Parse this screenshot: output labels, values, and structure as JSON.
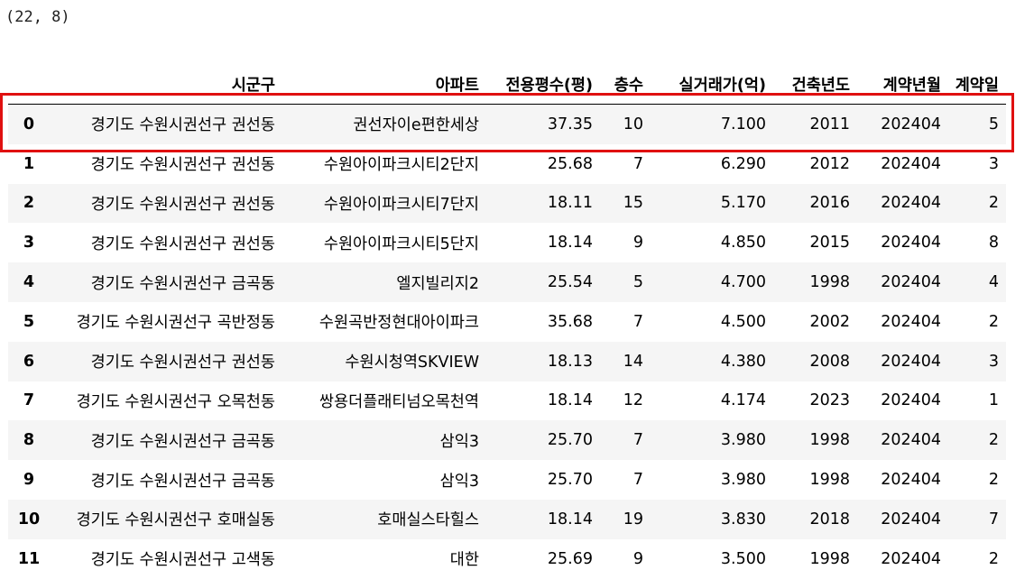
{
  "output": {
    "shape_text": "(22, 8)"
  },
  "highlight": {
    "color": "#e01010",
    "row_index": 0
  },
  "table": {
    "columns": [
      "",
      "시군구",
      "아파트",
      "전용평수(평)",
      "층수",
      "실거래가(억)",
      "건축년도",
      "계약년월",
      "계약일"
    ],
    "rows": [
      [
        "0",
        "경기도 수원시권선구 권선동",
        "권선자이e편한세상",
        "37.35",
        "10",
        "7.100",
        "2011",
        "202404",
        "5"
      ],
      [
        "1",
        "경기도 수원시권선구 권선동",
        "수원아이파크시티2단지",
        "25.68",
        "7",
        "6.290",
        "2012",
        "202404",
        "3"
      ],
      [
        "2",
        "경기도 수원시권선구 권선동",
        "수원아이파크시티7단지",
        "18.11",
        "15",
        "5.170",
        "2016",
        "202404",
        "2"
      ],
      [
        "3",
        "경기도 수원시권선구 권선동",
        "수원아이파크시티5단지",
        "18.14",
        "9",
        "4.850",
        "2015",
        "202404",
        "8"
      ],
      [
        "4",
        "경기도 수원시권선구 금곡동",
        "엘지빌리지2",
        "25.54",
        "5",
        "4.700",
        "1998",
        "202404",
        "4"
      ],
      [
        "5",
        "경기도 수원시권선구 곡반정동",
        "수원곡반정현대아이파크",
        "35.68",
        "7",
        "4.500",
        "2002",
        "202404",
        "2"
      ],
      [
        "6",
        "경기도 수원시권선구 권선동",
        "수원시청역SKVIEW",
        "18.13",
        "14",
        "4.380",
        "2008",
        "202404",
        "3"
      ],
      [
        "7",
        "경기도 수원시권선구 오목천동",
        "쌍용더플래티넘오목천역",
        "18.14",
        "12",
        "4.174",
        "2023",
        "202404",
        "1"
      ],
      [
        "8",
        "경기도 수원시권선구 금곡동",
        "삼익3",
        "25.70",
        "7",
        "3.980",
        "1998",
        "202404",
        "2"
      ],
      [
        "9",
        "경기도 수원시권선구 금곡동",
        "삼익3",
        "25.70",
        "7",
        "3.980",
        "1998",
        "202404",
        "2"
      ],
      [
        "10",
        "경기도 수원시권선구 호매실동",
        "호매실스타힐스",
        "18.14",
        "19",
        "3.830",
        "2018",
        "202404",
        "7"
      ],
      [
        "11",
        "경기도 수원시권선구 고색동",
        "대한",
        "25.69",
        "9",
        "3.500",
        "1998",
        "202404",
        "2"
      ]
    ]
  }
}
